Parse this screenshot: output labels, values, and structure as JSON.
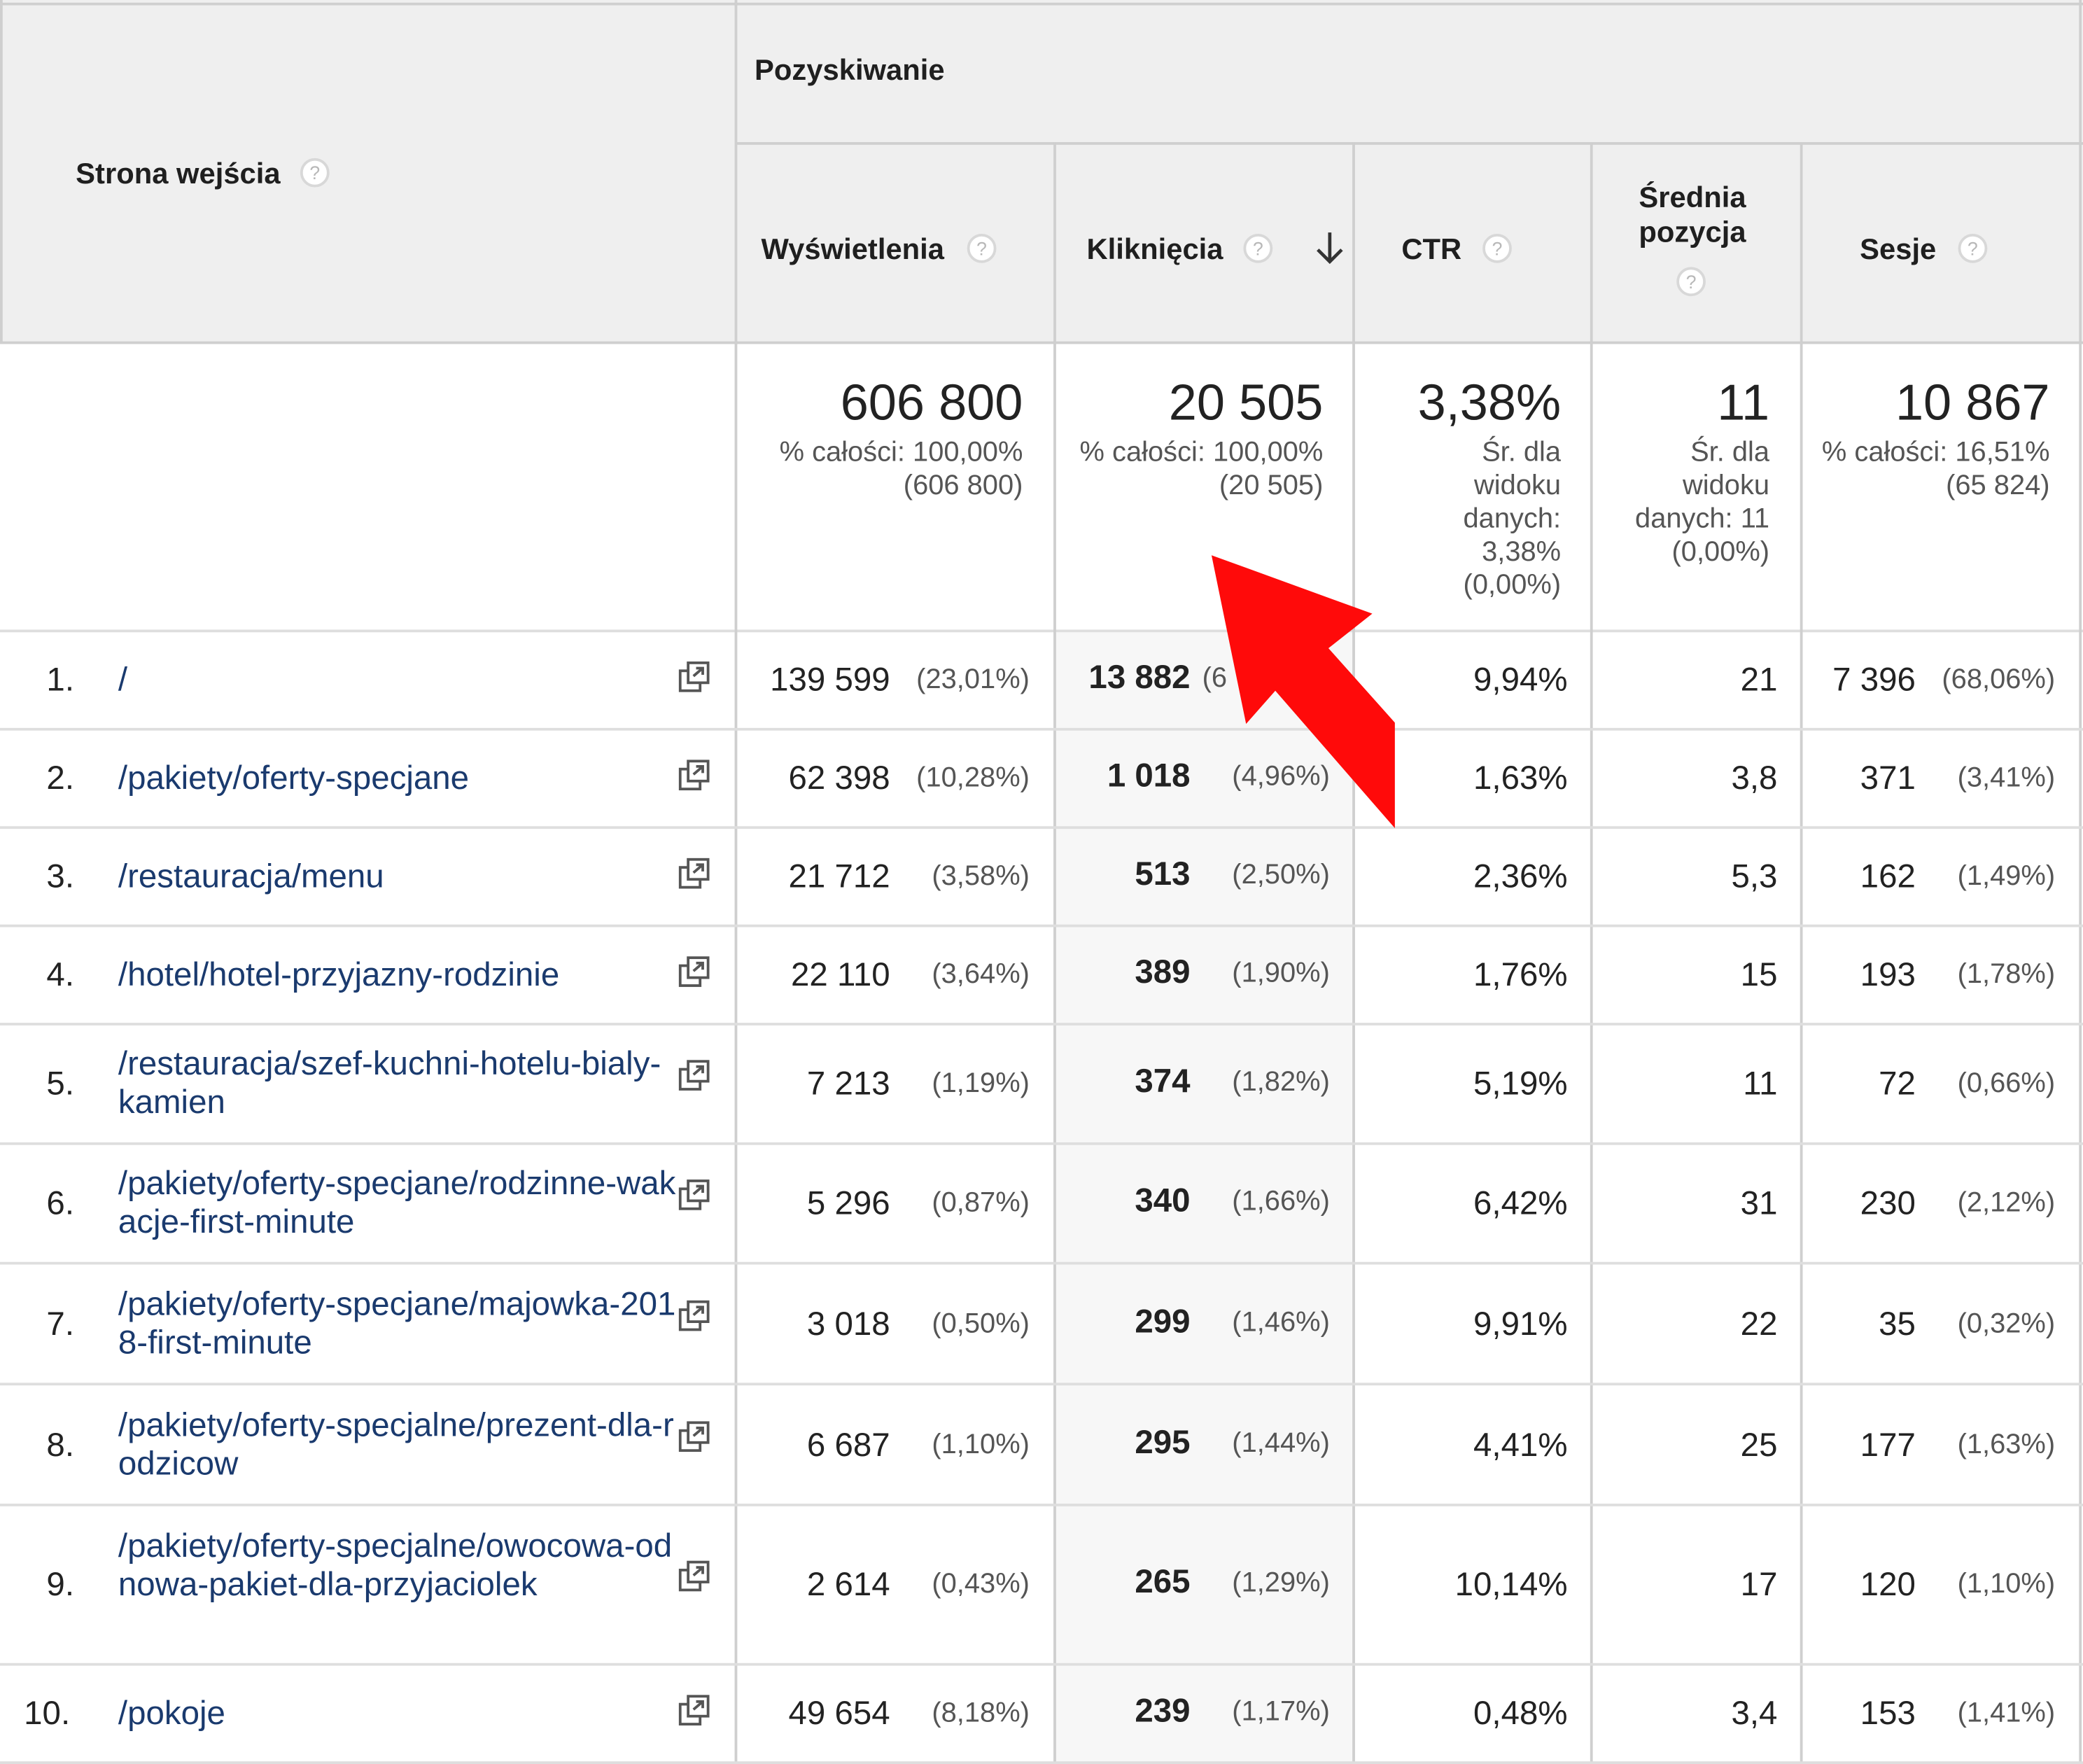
{
  "header": {
    "dimension_label": "Strona wejścia",
    "group_label": "Pozyskiwanie",
    "help_glyph": "?",
    "sort_icon": "arrow-down-icon",
    "columns": [
      {
        "label": "Wyświetlenia"
      },
      {
        "label": "Kliknięcia"
      },
      {
        "label": "CTR"
      },
      {
        "label": "Średnia pozycja"
      },
      {
        "label": "Sesje"
      }
    ]
  },
  "totals": {
    "impressions": {
      "value": "606 800",
      "sub": "% całości: 100,00% (606 800)"
    },
    "clicks": {
      "value": "20 505",
      "sub": "% całości: 100,00% (20 505)"
    },
    "ctr": {
      "value": "3,38%",
      "sub": "Śr. dla widoku danych: 3,38% (0,00%)"
    },
    "position": {
      "value": "11",
      "sub": "Śr. dla widoku danych: 11 (0,00%)"
    },
    "sessions": {
      "value": "10 867",
      "sub": "% całości: 16,51% (65 824)"
    }
  },
  "rows": [
    {
      "idx": "1.",
      "page": "/",
      "imp": "139 599",
      "imp_pct": "(23,01%)",
      "clk": "13 882",
      "clk_pct": "(6",
      "ctr": "9,94%",
      "pos": "21",
      "ses": "7 396",
      "ses_pct": "(68,06%)"
    },
    {
      "idx": "2.",
      "page": "/pakiety/oferty-specjane",
      "imp": "62 398",
      "imp_pct": "(10,28%)",
      "clk": "1 018",
      "clk_pct": "(4,96%)",
      "ctr": "1,63%",
      "pos": "3,8",
      "ses": "371",
      "ses_pct": "(3,41%)"
    },
    {
      "idx": "3.",
      "page": "/restauracja/menu",
      "imp": "21 712",
      "imp_pct": "(3,58%)",
      "clk": "513",
      "clk_pct": "(2,50%)",
      "ctr": "2,36%",
      "pos": "5,3",
      "ses": "162",
      "ses_pct": "(1,49%)"
    },
    {
      "idx": "4.",
      "page": "/hotel/hotel-przyjazny-rodzinie",
      "imp": "22 110",
      "imp_pct": "(3,64%)",
      "clk": "389",
      "clk_pct": "(1,90%)",
      "ctr": "1,76%",
      "pos": "15",
      "ses": "193",
      "ses_pct": "(1,78%)"
    },
    {
      "idx": "5.",
      "page": "/restauracja/szef-kuchni-hotelu-bialy-kamien",
      "imp": "7 213",
      "imp_pct": "(1,19%)",
      "clk": "374",
      "clk_pct": "(1,82%)",
      "ctr": "5,19%",
      "pos": "11",
      "ses": "72",
      "ses_pct": "(0,66%)"
    },
    {
      "idx": "6.",
      "page": "/pakiety/oferty-specjane/rodzinne-wakacje-first-minute",
      "imp": "5 296",
      "imp_pct": "(0,87%)",
      "clk": "340",
      "clk_pct": "(1,66%)",
      "ctr": "6,42%",
      "pos": "31",
      "ses": "230",
      "ses_pct": "(2,12%)"
    },
    {
      "idx": "7.",
      "page": "/pakiety/oferty-specjane/majowka-2018-first-minute",
      "imp": "3 018",
      "imp_pct": "(0,50%)",
      "clk": "299",
      "clk_pct": "(1,46%)",
      "ctr": "9,91%",
      "pos": "22",
      "ses": "35",
      "ses_pct": "(0,32%)"
    },
    {
      "idx": "8.",
      "page": "/pakiety/oferty-specjalne/prezent-dla-rodzicow",
      "imp": "6 687",
      "imp_pct": "(1,10%)",
      "clk": "295",
      "clk_pct": "(1,44%)",
      "ctr": "4,41%",
      "pos": "25",
      "ses": "177",
      "ses_pct": "(1,63%)"
    },
    {
      "idx": "9.",
      "page": "/pakiety/oferty-specjalne/owocowa-odnowa-pakiet-dla-przyjaciolek",
      "imp": "2 614",
      "imp_pct": "(0,43%)",
      "clk": "265",
      "clk_pct": "(1,29%)",
      "ctr": "10,14%",
      "pos": "17",
      "ses": "120",
      "ses_pct": "(1,10%)"
    },
    {
      "idx": "10.",
      "page": "/pokoje",
      "imp": "49 654",
      "imp_pct": "(8,18%)",
      "clk": "239",
      "clk_pct": "(1,17%)",
      "ctr": "0,48%",
      "pos": "3,4",
      "ses": "153",
      "ses_pct": "(1,41%)"
    }
  ],
  "icons": {
    "open_page": "external-link-icon",
    "annotation": "red-arrow-annotation"
  },
  "colors": {
    "link": "#1a3a6e",
    "header_bg": "#efefef",
    "arrow": "#ff0000"
  }
}
